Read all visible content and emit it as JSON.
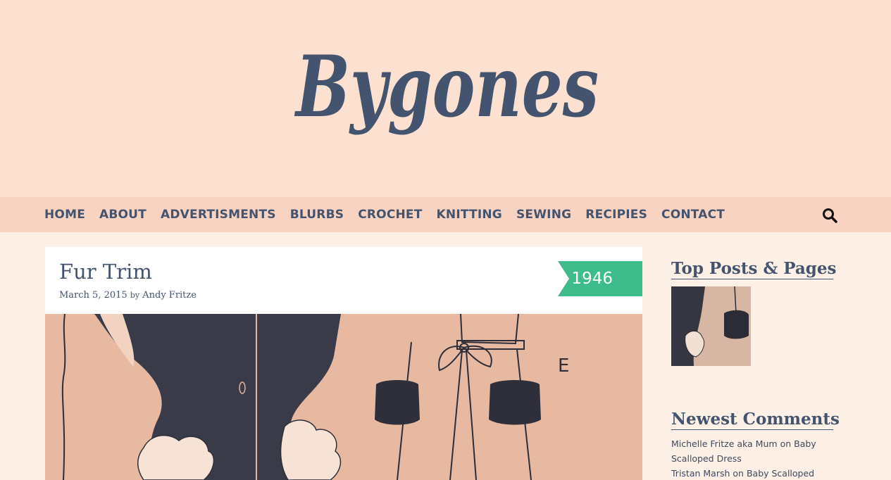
{
  "site": {
    "logo_text": "Bygones",
    "colors": {
      "header_bg": "#fde1d0",
      "nav_bg": "#f8d3c1",
      "page_bg": "#fdf0e7",
      "text": "#44546e",
      "ribbon": "#3fbc8b"
    }
  },
  "nav": {
    "items": [
      {
        "label": "HOME"
      },
      {
        "label": "ABOUT"
      },
      {
        "label": "ADVERTISMENTS"
      },
      {
        "label": "BLURBS"
      },
      {
        "label": "CROCHET"
      },
      {
        "label": "KNITTING"
      },
      {
        "label": "SEWING"
      },
      {
        "label": "RECIPIES"
      },
      {
        "label": "CONTACT"
      }
    ],
    "search_icon": "search-icon"
  },
  "post": {
    "title": "Fur Trim",
    "date": "March 5, 2015",
    "by": "by",
    "author": "Andy Fritze",
    "year_badge": "1946",
    "image_letter": "E"
  },
  "sidebar": {
    "top_posts_title": "Top Posts & Pages",
    "comments_title": "Newest Comments",
    "comments": [
      {
        "author": "Michelle Fritze aka Mum",
        "on": "on",
        "post": "Baby Scalloped Dress"
      },
      {
        "author": "Tristan Marsh",
        "on": "on",
        "post": "Baby Scalloped Dress"
      }
    ]
  }
}
